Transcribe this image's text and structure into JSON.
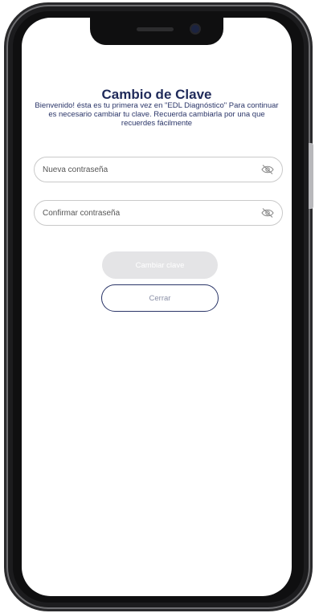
{
  "page": {
    "title": "Cambio de Clave",
    "subtitle": "Bienvenido! ésta es tu primera vez en \"EDL Diagnóstico\" Para continuar es necesario cambiar tu clave. Recuerda cambiarla por una que recuerdes fácilmente"
  },
  "form": {
    "new_password": {
      "placeholder": "Nueva contraseña",
      "value": "",
      "toggle_icon": "eye-off-icon"
    },
    "confirm_password": {
      "placeholder": "Confirmar contraseña",
      "value": "",
      "toggle_icon": "eye-off-icon"
    }
  },
  "actions": {
    "change_label": "Cambiar clave",
    "close_label": "Cerrar"
  },
  "colors": {
    "title": "#1f2a5a",
    "disabled_button": "#e4e4e6",
    "outline_button_border": "#2a3568"
  }
}
